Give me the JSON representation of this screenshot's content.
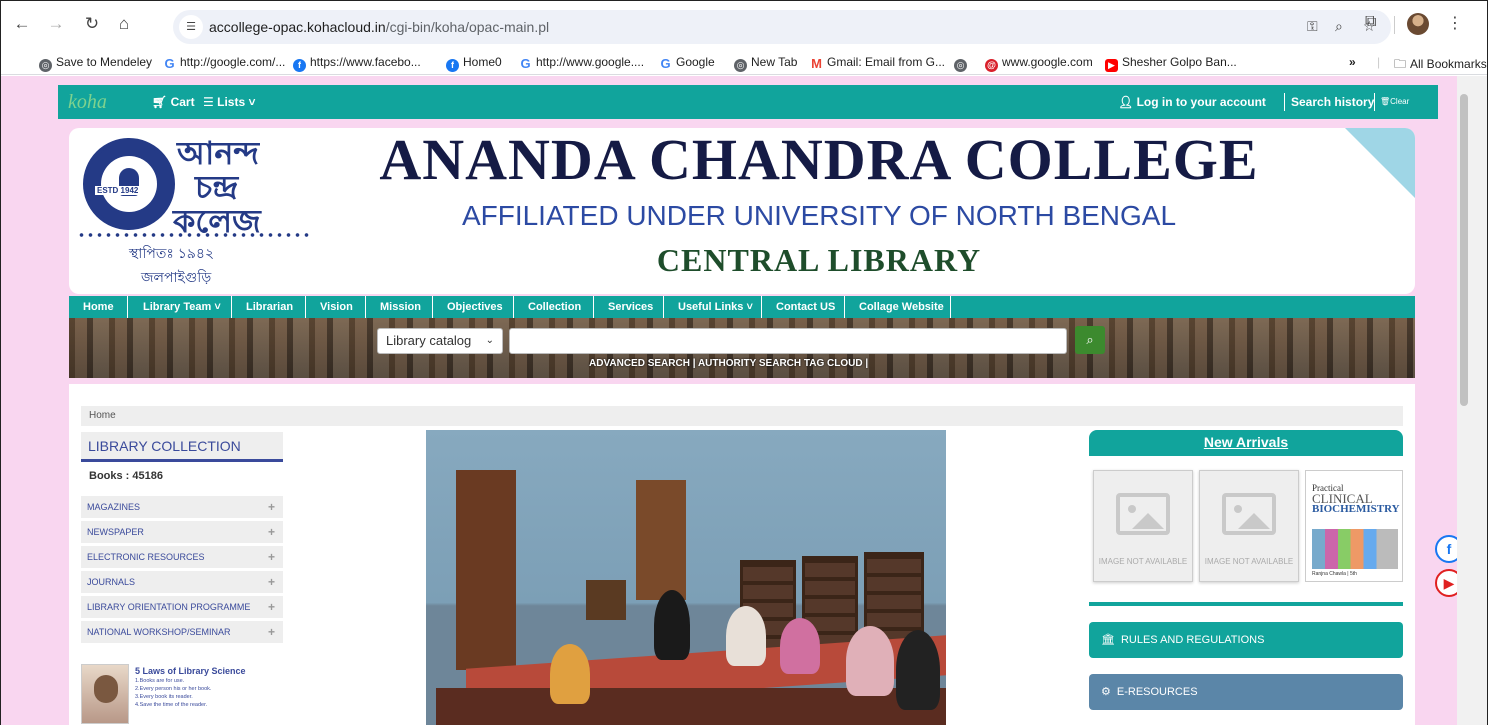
{
  "browser": {
    "url_host": "accollege-opac.kohacloud.in",
    "url_path": "/cgi-bin/koha/opac-main.pl",
    "bookmarks": [
      {
        "label": "Save to Mendeley",
        "icon": "globe-icon"
      },
      {
        "label": "http://google.com/...",
        "icon": "google-icon"
      },
      {
        "label": "https://www.facebo...",
        "icon": "facebook-icon"
      },
      {
        "label": "Home0",
        "icon": "facebook-icon"
      },
      {
        "label": "http://www.google....",
        "icon": "google-icon"
      },
      {
        "label": "Google",
        "icon": "google-icon"
      },
      {
        "label": "New Tab",
        "icon": "globe-icon"
      },
      {
        "label": "Gmail: Email from G...",
        "icon": "gmail-icon"
      },
      {
        "label": "",
        "icon": "globe-icon"
      },
      {
        "label": "www.google.com",
        "icon": "red-circle-icon"
      },
      {
        "label": "Shesher Golpo Ban...",
        "icon": "youtube-icon"
      }
    ],
    "more_bookmarks": "»",
    "all_bookmarks": "All Bookmarks"
  },
  "koha": {
    "logo": "koha",
    "cart": "Cart",
    "lists": "Lists",
    "login": "Log in to your account",
    "search_history": "Search history",
    "clear": "Clear"
  },
  "banner": {
    "bengali_line1": "আনন্দ",
    "bengali_line2": "চন্দ্র",
    "bengali_line3": "কলেজ",
    "estd": "ESTD 1942",
    "bengali_est": "স্থাপিতঃ ১৯৪২",
    "bengali_place": "জলপাইগুড়ি",
    "title": "ANANDA CHANDRA COLLEGE",
    "subtitle": "AFFILIATED UNDER UNIVERSITY OF NORTH BENGAL",
    "library": "CENTRAL LIBRARY"
  },
  "nav": [
    {
      "label": "Home"
    },
    {
      "label": "Library Team ˅"
    },
    {
      "label": "Librarian"
    },
    {
      "label": "Vision"
    },
    {
      "label": "Mission"
    },
    {
      "label": "Objectives"
    },
    {
      "label": "Collection"
    },
    {
      "label": "Services"
    },
    {
      "label": "Useful Links ˅"
    },
    {
      "label": "Contact US"
    },
    {
      "label": "Collage Website"
    }
  ],
  "search": {
    "scope": "Library catalog",
    "advanced": "ADVANCED SEARCH",
    "authority": "AUTHORITY SEARCH",
    "tag_cloud": "TAG CLOUD",
    "sep": "|"
  },
  "breadcrumb": "Home",
  "collection": {
    "heading": "LIBRARY COLLECTION",
    "books": "Books : 45186",
    "items": [
      {
        "label": "MAGAZINES"
      },
      {
        "label": "NEWSPAPER"
      },
      {
        "label": "ELECTRONIC RESOURCES"
      },
      {
        "label": "JOURNALS"
      },
      {
        "label": "LIBRARY ORIENTATION PROGRAMME"
      },
      {
        "label": "NATIONAL WORKSHOP/SEMINAR"
      }
    ]
  },
  "laws": {
    "title": "5 Laws of Library Science",
    "lines": [
      "1.Books are for use.",
      "2.Every person his or her book.",
      "3.Every book its reader.",
      "4.Save the time of the reader."
    ]
  },
  "new_arrivals": {
    "heading": "New Arrivals",
    "unavailable": "IMAGE NOT AVAILABLE",
    "cover_line1": "Practical",
    "cover_line2": "CLINICAL",
    "cover_line3": "BIOCHEMISTRY",
    "cover_author": "Ranjna Chawla | 5th"
  },
  "side_links": {
    "rules": "RULES AND REGULATIONS",
    "eresources": "E-RESOURCES"
  },
  "colors": {
    "teal": "#11a49c",
    "navy": "#3a4a9b",
    "pink": "#f9d6f0",
    "steel": "#5b86a8"
  }
}
